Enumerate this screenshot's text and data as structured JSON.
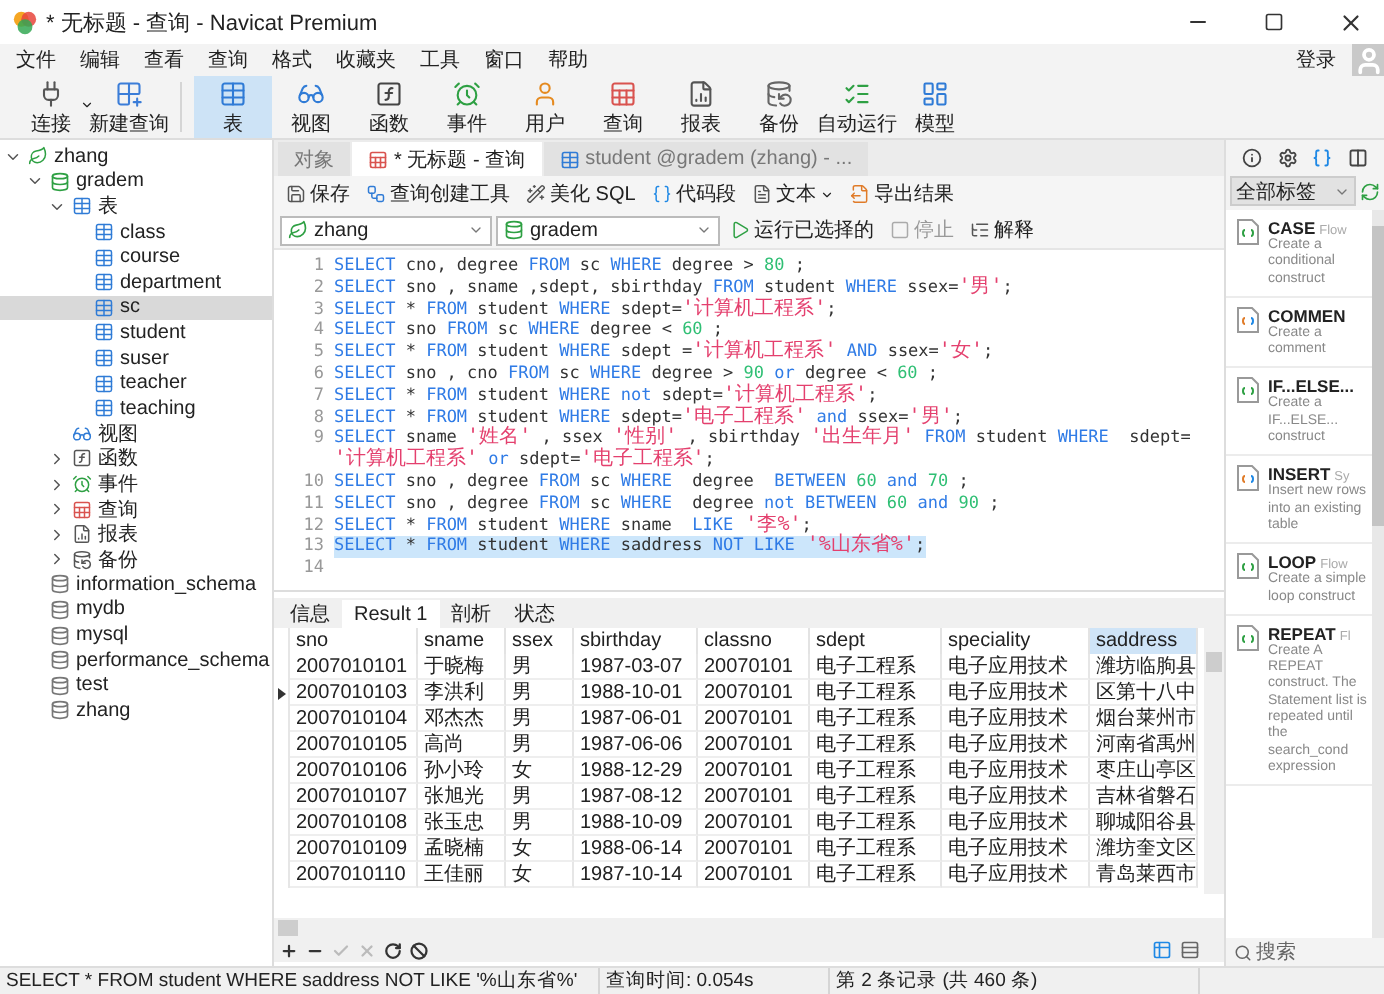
{
  "window": {
    "title": "* 无标题 - 查询 - Navicat Premium"
  },
  "menu": {
    "items": [
      "文件",
      "编辑",
      "查看",
      "查询",
      "格式",
      "收藏夹",
      "工具",
      "窗口",
      "帮助"
    ],
    "login": "登录"
  },
  "toolbar": [
    {
      "label": "连接",
      "kind": "connect",
      "selected": false,
      "dropdown": true
    },
    {
      "label": "新建查询",
      "kind": "newquery",
      "selected": false
    },
    {
      "label": "表",
      "kind": "table",
      "selected": true
    },
    {
      "label": "视图",
      "kind": "view",
      "selected": false
    },
    {
      "label": "函数",
      "kind": "function",
      "selected": false
    },
    {
      "label": "事件",
      "kind": "event",
      "selected": false
    },
    {
      "label": "用户",
      "kind": "user",
      "selected": false
    },
    {
      "label": "查询",
      "kind": "query",
      "selected": false
    },
    {
      "label": "报表",
      "kind": "report",
      "selected": false
    },
    {
      "label": "备份",
      "kind": "backup",
      "selected": false
    },
    {
      "label": "自动运行",
      "kind": "schedule",
      "selected": false
    },
    {
      "label": "模型",
      "kind": "model",
      "selected": false
    }
  ],
  "sidebar": {
    "tree": [
      {
        "label": "zhang",
        "kind": "connection",
        "expanded": true,
        "selected": false,
        "children": [
          {
            "label": "gradem",
            "kind": "database",
            "open": true,
            "expanded": true,
            "selected": false,
            "children": [
              {
                "label": "表",
                "kind": "tables",
                "expanded": true,
                "selected": false,
                "children": [
                  {
                    "label": "class",
                    "kind": "table",
                    "selected": false
                  },
                  {
                    "label": "course",
                    "kind": "table",
                    "selected": false
                  },
                  {
                    "label": "department",
                    "kind": "table",
                    "selected": false
                  },
                  {
                    "label": "sc",
                    "kind": "table",
                    "selected": true
                  },
                  {
                    "label": "student",
                    "kind": "table",
                    "selected": false
                  },
                  {
                    "label": "suser",
                    "kind": "table",
                    "selected": false
                  },
                  {
                    "label": "teacher",
                    "kind": "table",
                    "selected": false
                  },
                  {
                    "label": "teaching",
                    "kind": "table",
                    "selected": false
                  }
                ]
              },
              {
                "label": "视图",
                "kind": "views",
                "selected": false
              },
              {
                "label": "函数",
                "kind": "functions",
                "expanded": false,
                "selected": false
              },
              {
                "label": "事件",
                "kind": "events",
                "expanded": false,
                "selected": false
              },
              {
                "label": "查询",
                "kind": "queries",
                "expanded": false,
                "selected": false
              },
              {
                "label": "报表",
                "kind": "reports",
                "expanded": false,
                "selected": false
              },
              {
                "label": "备份",
                "kind": "backups",
                "expanded": false,
                "selected": false
              }
            ]
          },
          {
            "label": "information_schema",
            "kind": "database",
            "open": false,
            "selected": false
          },
          {
            "label": "mydb",
            "kind": "database",
            "open": false,
            "selected": false
          },
          {
            "label": "mysql",
            "kind": "database",
            "open": false,
            "selected": false
          },
          {
            "label": "performance_schema",
            "kind": "database",
            "open": false,
            "selected": false
          },
          {
            "label": "test",
            "kind": "database",
            "open": false,
            "selected": false
          },
          {
            "label": "zhang",
            "kind": "database",
            "open": false,
            "selected": false
          }
        ]
      }
    ]
  },
  "tabs": [
    {
      "label": "对象",
      "kind": "objects",
      "selected": false
    },
    {
      "label": "* 无标题 - 查询",
      "kind": "query",
      "selected": true
    },
    {
      "label": "student @gradem (zhang) - ...",
      "kind": "table",
      "selected": false
    }
  ],
  "query_toolbar": [
    {
      "label": "保存",
      "kind": "save"
    },
    {
      "label": "查询创建工具",
      "kind": "builder"
    },
    {
      "label": "美化 SQL",
      "kind": "beautify"
    },
    {
      "label": "代码段",
      "kind": "snippet"
    },
    {
      "label": "文本",
      "kind": "text",
      "dropdown": true
    },
    {
      "label": "导出结果",
      "kind": "export"
    }
  ],
  "connection_select": {
    "value": "zhang"
  },
  "database_select": {
    "value": "gradem"
  },
  "run_toolbar": [
    {
      "label": "运行已选择的",
      "kind": "run",
      "disabled": false
    },
    {
      "label": "停止",
      "kind": "stop",
      "disabled": true
    },
    {
      "label": "解释",
      "kind": "explain",
      "disabled": false
    }
  ],
  "editor": {
    "lines": [
      {
        "number": "1",
        "tokens": [
          {
            "kind": "keyword",
            "text": "SELECT"
          },
          {
            "kind": "plain",
            "text": " cno, degree "
          },
          {
            "kind": "keyword",
            "text": "FROM"
          },
          {
            "kind": "plain",
            "text": " sc "
          },
          {
            "kind": "keyword",
            "text": "WHERE"
          },
          {
            "kind": "plain",
            "text": " degree > "
          },
          {
            "kind": "number",
            "text": "80"
          },
          {
            "kind": "plain",
            "text": " ;"
          }
        ]
      },
      {
        "number": "2",
        "tokens": [
          {
            "kind": "keyword",
            "text": "SELECT"
          },
          {
            "kind": "plain",
            "text": " sno , sname ,sdept, sbirthday "
          },
          {
            "kind": "keyword",
            "text": "FROM"
          },
          {
            "kind": "plain",
            "text": " student "
          },
          {
            "kind": "keyword",
            "text": "WHERE"
          },
          {
            "kind": "plain",
            "text": " ssex="
          },
          {
            "kind": "string",
            "text": "'男'"
          },
          {
            "kind": "plain",
            "text": ";"
          }
        ]
      },
      {
        "number": "3",
        "tokens": [
          {
            "kind": "keyword",
            "text": "SELECT"
          },
          {
            "kind": "plain",
            "text": " * "
          },
          {
            "kind": "keyword",
            "text": "FROM"
          },
          {
            "kind": "plain",
            "text": " student "
          },
          {
            "kind": "keyword",
            "text": "WHERE"
          },
          {
            "kind": "plain",
            "text": " sdept="
          },
          {
            "kind": "string",
            "text": "'计算机工程系'"
          },
          {
            "kind": "plain",
            "text": ";"
          }
        ]
      },
      {
        "number": "4",
        "tokens": [
          {
            "kind": "keyword",
            "text": "SELECT"
          },
          {
            "kind": "plain",
            "text": " sno "
          },
          {
            "kind": "keyword",
            "text": "FROM"
          },
          {
            "kind": "plain",
            "text": " sc "
          },
          {
            "kind": "keyword",
            "text": "WHERE"
          },
          {
            "kind": "plain",
            "text": " degree < "
          },
          {
            "kind": "number",
            "text": "60"
          },
          {
            "kind": "plain",
            "text": " ;"
          }
        ]
      },
      {
        "number": "5",
        "tokens": [
          {
            "kind": "keyword",
            "text": "SELECT"
          },
          {
            "kind": "plain",
            "text": " * "
          },
          {
            "kind": "keyword",
            "text": "FROM"
          },
          {
            "kind": "plain",
            "text": " student "
          },
          {
            "kind": "keyword",
            "text": "WHERE"
          },
          {
            "kind": "plain",
            "text": " sdept ="
          },
          {
            "kind": "string",
            "text": "'计算机工程系'"
          },
          {
            "kind": "keyword",
            "text": " AND"
          },
          {
            "kind": "plain",
            "text": " ssex="
          },
          {
            "kind": "string",
            "text": "'女'"
          },
          {
            "kind": "plain",
            "text": ";"
          }
        ]
      },
      {
        "number": "6",
        "tokens": [
          {
            "kind": "keyword",
            "text": "SELECT"
          },
          {
            "kind": "plain",
            "text": " sno , cno "
          },
          {
            "kind": "keyword",
            "text": "FROM"
          },
          {
            "kind": "plain",
            "text": " sc "
          },
          {
            "kind": "keyword",
            "text": "WHERE"
          },
          {
            "kind": "plain",
            "text": " degree > "
          },
          {
            "kind": "number",
            "text": "90"
          },
          {
            "kind": "keyword",
            "text": " or"
          },
          {
            "kind": "plain",
            "text": " degree < "
          },
          {
            "kind": "number",
            "text": "60"
          },
          {
            "kind": "plain",
            "text": " ;"
          }
        ]
      },
      {
        "number": "7",
        "tokens": [
          {
            "kind": "keyword",
            "text": "SELECT"
          },
          {
            "kind": "plain",
            "text": " * "
          },
          {
            "kind": "keyword",
            "text": "FROM"
          },
          {
            "kind": "plain",
            "text": " student "
          },
          {
            "kind": "keyword",
            "text": "WHERE"
          },
          {
            "kind": "keyword",
            "text": " not"
          },
          {
            "kind": "plain",
            "text": " sdept="
          },
          {
            "kind": "string",
            "text": "'计算机工程系'"
          },
          {
            "kind": "plain",
            "text": ";"
          }
        ]
      },
      {
        "number": "8",
        "tokens": [
          {
            "kind": "keyword",
            "text": "SELECT"
          },
          {
            "kind": "plain",
            "text": " * "
          },
          {
            "kind": "keyword",
            "text": "FROM"
          },
          {
            "kind": "plain",
            "text": " student "
          },
          {
            "kind": "keyword",
            "text": "WHERE"
          },
          {
            "kind": "plain",
            "text": " sdept="
          },
          {
            "kind": "string",
            "text": "'电子工程系'"
          },
          {
            "kind": "keyword",
            "text": " and"
          },
          {
            "kind": "plain",
            "text": " ssex="
          },
          {
            "kind": "string",
            "text": "'男'"
          },
          {
            "kind": "plain",
            "text": ";"
          }
        ]
      },
      {
        "number": "9",
        "tokens": [
          {
            "kind": "keyword",
            "text": "SELECT"
          },
          {
            "kind": "plain",
            "text": " sname "
          },
          {
            "kind": "string",
            "text": "'姓名'"
          },
          {
            "kind": "plain",
            "text": " , ssex "
          },
          {
            "kind": "string",
            "text": "'性别'"
          },
          {
            "kind": "plain",
            "text": " , sbirthday "
          },
          {
            "kind": "string",
            "text": "'出生年月'"
          },
          {
            "kind": "keyword",
            "text": " FROM"
          },
          {
            "kind": "plain",
            "text": " student "
          },
          {
            "kind": "keyword",
            "text": "WHERE"
          },
          {
            "kind": "plain",
            "text": "  sdept="
          }
        ]
      },
      {
        "tokens": [
          {
            "kind": "string",
            "text": "'计算机工程系'"
          },
          {
            "kind": "keyword",
            "text": " or"
          },
          {
            "kind": "plain",
            "text": " sdept="
          },
          {
            "kind": "string",
            "text": "'电子工程系'"
          },
          {
            "kind": "plain",
            "text": ";"
          }
        ]
      },
      {
        "number": "10",
        "tokens": [
          {
            "kind": "keyword",
            "text": "SELECT"
          },
          {
            "kind": "plain",
            "text": " sno , degree "
          },
          {
            "kind": "keyword",
            "text": "FROM"
          },
          {
            "kind": "plain",
            "text": " sc "
          },
          {
            "kind": "keyword",
            "text": "WHERE"
          },
          {
            "kind": "plain",
            "text": "  degree  "
          },
          {
            "kind": "keyword",
            "text": "BETWEEN"
          },
          {
            "kind": "number",
            "text": " 60"
          },
          {
            "kind": "keyword",
            "text": " and"
          },
          {
            "kind": "number",
            "text": " 70"
          },
          {
            "kind": "plain",
            "text": " ;"
          }
        ]
      },
      {
        "number": "11",
        "tokens": [
          {
            "kind": "keyword",
            "text": "SELECT"
          },
          {
            "kind": "plain",
            "text": " sno , degree "
          },
          {
            "kind": "keyword",
            "text": "FROM"
          },
          {
            "kind": "plain",
            "text": " sc "
          },
          {
            "kind": "keyword",
            "text": "WHERE"
          },
          {
            "kind": "plain",
            "text": "  degree "
          },
          {
            "kind": "keyword",
            "text": "not BETWEEN"
          },
          {
            "kind": "number",
            "text": " 60"
          },
          {
            "kind": "keyword",
            "text": " and"
          },
          {
            "kind": "number",
            "text": " 90"
          },
          {
            "kind": "plain",
            "text": " ;"
          }
        ]
      },
      {
        "number": "12",
        "tokens": [
          {
            "kind": "keyword",
            "text": "SELECT"
          },
          {
            "kind": "plain",
            "text": " * "
          },
          {
            "kind": "keyword",
            "text": "FROM"
          },
          {
            "kind": "plain",
            "text": " student "
          },
          {
            "kind": "keyword",
            "text": "WHERE"
          },
          {
            "kind": "plain",
            "text": " sname  "
          },
          {
            "kind": "keyword",
            "text": "LIKE"
          },
          {
            "kind": "string",
            "text": " '李%'"
          },
          {
            "kind": "plain",
            "text": ";"
          }
        ]
      },
      {
        "number": "13",
        "selected": true,
        "tokens": [
          {
            "kind": "keyword",
            "text": "SELECT"
          },
          {
            "kind": "plain",
            "text": " * "
          },
          {
            "kind": "keyword",
            "text": "FROM"
          },
          {
            "kind": "plain",
            "text": " student "
          },
          {
            "kind": "keyword",
            "text": "WHERE"
          },
          {
            "kind": "plain",
            "text": " saddress "
          },
          {
            "kind": "keyword",
            "text": "NOT LIKE"
          },
          {
            "kind": "string",
            "text": " '%山东省%'"
          },
          {
            "kind": "plain",
            "text": ";"
          }
        ]
      },
      {
        "number": "14"
      }
    ]
  },
  "result_tabs": [
    {
      "label": "信息",
      "selected": false
    },
    {
      "label": "Result 1",
      "selected": true
    },
    {
      "label": "剖析",
      "selected": false
    },
    {
      "label": "状态",
      "selected": false
    }
  ],
  "table": {
    "columns": [
      {
        "label": "sno",
        "selected": false
      },
      {
        "label": "sname",
        "selected": false
      },
      {
        "label": "ssex",
        "selected": false
      },
      {
        "label": "sbirthday",
        "selected": false
      },
      {
        "label": "classno",
        "selected": false
      },
      {
        "label": "sdept",
        "selected": false
      },
      {
        "label": "speciality",
        "selected": false
      },
      {
        "label": "saddress",
        "selected": true
      }
    ],
    "rows": [
      {
        "current": false,
        "cells": [
          "2007010101",
          "于晓梅",
          "男",
          "1987-03-07",
          "20070101",
          "电子工程系",
          "电子应用技术",
          "潍坊临朐县"
        ]
      },
      {
        "current": true,
        "cells": [
          "2007010103",
          "李洪利",
          "男",
          "1988-10-01",
          "20070101",
          "电子工程系",
          "电子应用技术",
          "区第十八中"
        ]
      },
      {
        "current": false,
        "cells": [
          "2007010104",
          "邓杰杰",
          "男",
          "1987-06-01",
          "20070101",
          "电子工程系",
          "电子应用技术",
          "烟台莱州市"
        ]
      },
      {
        "current": false,
        "cells": [
          "2007010105",
          "高尚",
          "男",
          "1987-06-06",
          "20070101",
          "电子工程系",
          "电子应用技术",
          "河南省禹州"
        ]
      },
      {
        "current": false,
        "cells": [
          "2007010106",
          "孙小玲",
          "女",
          "1988-12-29",
          "20070101",
          "电子工程系",
          "电子应用技术",
          "枣庄山亭区"
        ]
      },
      {
        "current": false,
        "cells": [
          "2007010107",
          "张旭光",
          "男",
          "1987-08-12",
          "20070101",
          "电子工程系",
          "电子应用技术",
          "吉林省磐石"
        ]
      },
      {
        "current": false,
        "cells": [
          "2007010108",
          "张玉忠",
          "男",
          "1988-10-09",
          "20070101",
          "电子工程系",
          "电子应用技术",
          "聊城阳谷县"
        ]
      },
      {
        "current": false,
        "cells": [
          "2007010109",
          "孟晓楠",
          "女",
          "1988-06-14",
          "20070101",
          "电子工程系",
          "电子应用技术",
          "潍坊奎文区"
        ]
      },
      {
        "current": false,
        "cells": [
          "2007010110",
          "王佳丽",
          "女",
          "1987-10-14",
          "20070101",
          "电子工程系",
          "电子应用技术",
          "青岛莱西市"
        ]
      }
    ]
  },
  "record_toolbar": [
    {
      "kind": "add",
      "disabled": false
    },
    {
      "kind": "delete",
      "disabled": false
    },
    {
      "kind": "apply",
      "disabled": true
    },
    {
      "kind": "discard",
      "disabled": true
    },
    {
      "kind": "refresh",
      "disabled": false
    },
    {
      "kind": "stop",
      "disabled": false
    }
  ],
  "snippets": {
    "filter": "全部标签",
    "tools": [
      {
        "kind": "info",
        "selected": false
      },
      {
        "kind": "settings",
        "selected": false
      },
      {
        "kind": "snippets",
        "selected": true
      },
      {
        "kind": "columns",
        "selected": false
      }
    ],
    "items": [
      {
        "title": "CASE",
        "tag": "Flow",
        "kind": "flow",
        "description": "Create a conditional construct"
      },
      {
        "title": "COMMEN",
        "kind": "syntax",
        "description": "Create a comment"
      },
      {
        "title": "IF...ELSE...",
        "kind": "flow",
        "description": "Create a IF...ELSE... construct"
      },
      {
        "title": "INSERT",
        "tag": "Sy",
        "kind": "syntax",
        "description": "Insert new rows into an existing table"
      },
      {
        "title": "LOOP",
        "tag": "Flow",
        "kind": "flow",
        "description": "Create a simple loop construct"
      },
      {
        "title": "REPEAT",
        "tag": "Fl",
        "kind": "flow",
        "description": "Create A REPEAT construct. The Statement list is repeated until the search_cond expression"
      }
    ],
    "search": {
      "placeholder": "搜索"
    }
  },
  "status_bar": {
    "sql": "SELECT * FROM student WHERE saddress NOT LIKE '%山东省%'",
    "time": "查询时间: 0.054s",
    "record": "第 2 条记录 (共 460 条)"
  }
}
